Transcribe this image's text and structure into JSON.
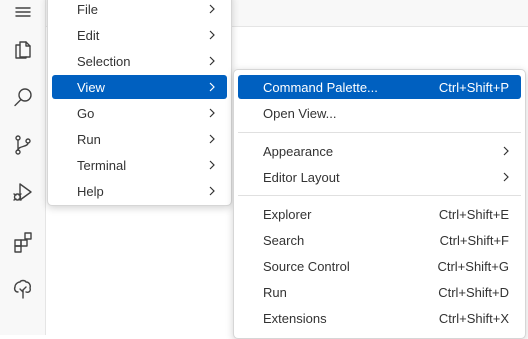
{
  "activity_bar": {
    "icons": [
      "hamburger-menu-icon",
      "files-icon",
      "search-icon",
      "source-control-icon",
      "run-debug-icon",
      "extensions-icon",
      "tree-icon"
    ]
  },
  "main_menu": {
    "items": [
      {
        "label": "File"
      },
      {
        "label": "Edit"
      },
      {
        "label": "Selection"
      },
      {
        "label": "View"
      },
      {
        "label": "Go"
      },
      {
        "label": "Run"
      },
      {
        "label": "Terminal"
      },
      {
        "label": "Help"
      }
    ]
  },
  "view_menu": {
    "command_palette": {
      "label": "Command Palette...",
      "shortcut": "Ctrl+Shift+P"
    },
    "open_view": {
      "label": "Open View..."
    },
    "appearance": {
      "label": "Appearance"
    },
    "editor_layout": {
      "label": "Editor Layout"
    },
    "explorer": {
      "label": "Explorer",
      "shortcut": "Ctrl+Shift+E"
    },
    "search": {
      "label": "Search",
      "shortcut": "Ctrl+Shift+F"
    },
    "source_control": {
      "label": "Source Control",
      "shortcut": "Ctrl+Shift+G"
    },
    "run": {
      "label": "Run",
      "shortcut": "Ctrl+Shift+D"
    },
    "extensions": {
      "label": "Extensions",
      "shortcut": "Ctrl+Shift+X"
    }
  },
  "colors": {
    "selection": "#0060c0",
    "menu_bg": "#ffffff"
  }
}
